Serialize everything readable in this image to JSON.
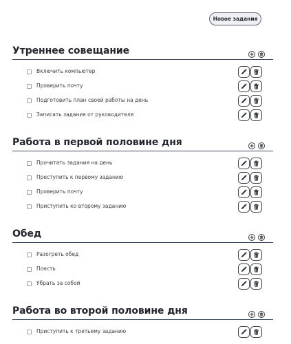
{
  "header": {
    "new_task_label": "Новое задания"
  },
  "icons": {
    "add": "plus-icon",
    "delete_section": "trash-icon",
    "edit": "pencil-icon",
    "delete_item": "trash-icon",
    "checkbox": "checkbox-empty"
  },
  "sections": [
    {
      "title": "Утреннее совещание",
      "items": [
        "Включить компьютер",
        "Проверить почту",
        "Подготовить план своей работы на день",
        "Записать задания от руководителя"
      ]
    },
    {
      "title": "Работа в первой половине дня",
      "items": [
        "Прочитать задания на день",
        "Преступить к первому заданию",
        "Проверить почту",
        "Приступить ко второму заданию"
      ]
    },
    {
      "title": "Обед",
      "items": [
        "Разогреть обед",
        "Поесть",
        "Убрать за собой"
      ]
    },
    {
      "title": "Работа во второй половине дня",
      "items": [
        "Приступить к третьему заданию"
      ]
    }
  ]
}
